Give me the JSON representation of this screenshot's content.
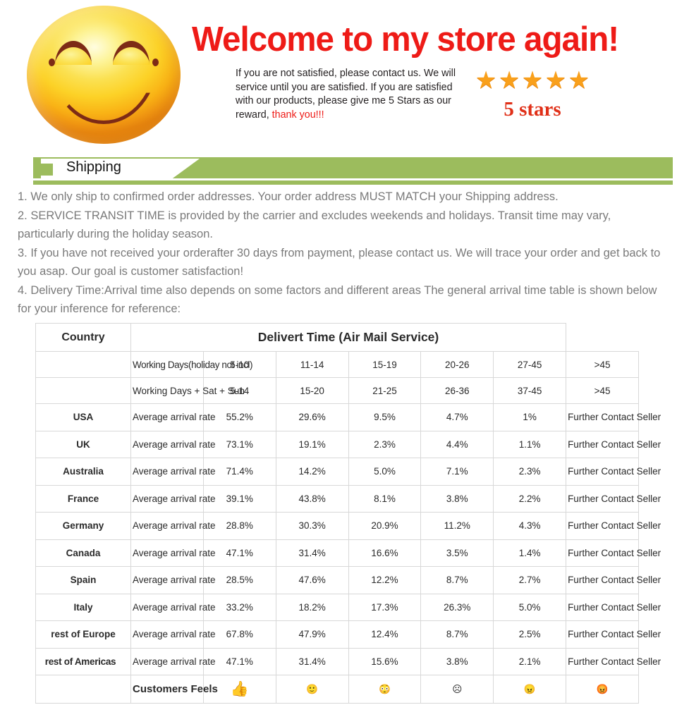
{
  "header": {
    "headline": "Welcome to my store again!",
    "blurb_main": "If you are not satisfied, please contact us. We will service until you are satisfied. If you are satisfied with our products, please give me 5 Stars as our reward, ",
    "blurb_thanks": "thank you!!!",
    "stars_label": "5 stars",
    "star_glyph": "★",
    "star_count": 5,
    "star_color": "#f9a01b",
    "headline_color": "#ee1b17",
    "smiley_icon": "smiley-face-icon"
  },
  "banner": {
    "title": "Shipping",
    "color": "#9cbc5d"
  },
  "notes": [
    "1. We only ship to confirmed order addresses. Your order address MUST MATCH your Shipping address.",
    "2. SERVICE TRANSIT TIME is provided by the carrier and excludes weekends and holidays. Transit time may vary, particularly during the holiday season.",
    "3. If you have not received your orderafter 30 days from payment, please contact us. We will trace your order and get back to you asap. Our goal is customer satisfaction!",
    "4. Delivery Time:Arrival time also depends on some factors and different areas The general arrival time table is shown below for your inference for reference:"
  ],
  "table": {
    "header": {
      "country": "Country",
      "delivery_time": "Delivert Time (Air Mail Service)"
    },
    "subrows": [
      {
        "label": "Working Days(holiday not incl)",
        "values": [
          "5-10",
          "11-14",
          "15-19",
          "20-26",
          "27-45"
        ],
        "last": ">45"
      },
      {
        "label": "Working Days + Sat + Sun",
        "values": [
          "5-14",
          "15-20",
          "21-25",
          "26-36",
          "37-45"
        ],
        "last": ">45"
      }
    ],
    "rate_label": "Average arrival rate",
    "last_cell": "Further Contact Seller",
    "rows": [
      {
        "country": "USA",
        "label": "Average arrival rate",
        "values": [
          "55.2%",
          "29.6%",
          "9.5%",
          "4.7%",
          "1%"
        ],
        "last": "Further Contact Seller"
      },
      {
        "country": "UK",
        "label": "Average arrival rate",
        "values": [
          "73.1%",
          "19.1%",
          "2.3%",
          "4.4%",
          "1.1%"
        ],
        "last": "Further Contact Seller"
      },
      {
        "country": "Australia",
        "label": "Average arrival rate",
        "values": [
          "71.4%",
          "14.2%",
          "5.0%",
          "7.1%",
          "2.3%"
        ],
        "last": "Further Contact Seller"
      },
      {
        "country": "France",
        "label": "Average arrival rate",
        "values": [
          "39.1%",
          "43.8%",
          "8.1%",
          "3.8%",
          "2.2%"
        ],
        "last": "Further Contact Seller"
      },
      {
        "country": "Germany",
        "label": "Average arrival rate",
        "values": [
          "28.8%",
          "30.3%",
          "20.9%",
          "11.2%",
          "4.3%"
        ],
        "last": "Further Contact Seller"
      },
      {
        "country": "Canada",
        "label": "Average arrival rate",
        "values": [
          "47.1%",
          "31.4%",
          "16.6%",
          "3.5%",
          "1.4%"
        ],
        "last": "Further Contact Seller"
      },
      {
        "country": "Spain",
        "label": "Average arrival rate",
        "values": [
          "28.5%",
          "47.6%",
          "12.2%",
          "8.7%",
          "2.7%"
        ],
        "last": "Further Contact Seller"
      },
      {
        "country": "Italy",
        "label": "Average arrival rate",
        "values": [
          "33.2%",
          "18.2%",
          "17.3%",
          "26.3%",
          "5.0%"
        ],
        "last": "Further Contact Seller"
      },
      {
        "country": "rest of Europe",
        "label": "Average arrival rate",
        "values": [
          "67.8%",
          "47.9%",
          "12.4%",
          "8.7%",
          "2.5%"
        ],
        "last": "Further Contact Seller"
      },
      {
        "country": "rest of Americas",
        "label": "Average arrival rate",
        "values": [
          "47.1%",
          "31.4%",
          "15.6%",
          "3.8%",
          "2.1%"
        ],
        "last": "Further Contact Seller"
      }
    ],
    "feels_row": {
      "country": "",
      "label": "Customers Feels",
      "icons": [
        "thumbs-up-icon",
        "smiling-face-icon",
        "surprised-face-icon",
        "frowning-face-icon",
        "angry-yelling-face-icon"
      ],
      "glyphs": [
        "👍",
        "🙂",
        "😳",
        "☹",
        "😠"
      ],
      "last_icon": "red-angry-face-icon",
      "last_glyph": "😡"
    }
  }
}
